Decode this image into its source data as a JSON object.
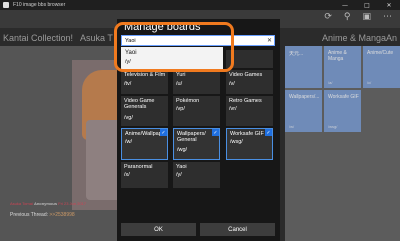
{
  "window": {
    "title": "F10 image bbs browser",
    "minimize_icon": "minimize-icon",
    "maximize_icon": "maximize-icon",
    "close_icon": "close-icon"
  },
  "appbar": {
    "icons": [
      "refresh-icon",
      "search-icon",
      "tabs-icon",
      "more-icon"
    ]
  },
  "boards": {
    "items": [
      "Kantai Collection!",
      "Asuka T",
      "Anime & Manga",
      "An"
    ]
  },
  "left_post": {
    "post_number": "1497247793",
    "meta_name": "Asuka Tomai",
    "meta_user": "Anonymous",
    "meta_date": "Fri 23 Jun 2017",
    "prev_label": "Previous Thread:",
    "prev_link": ">>2538998"
  },
  "right_tiles": [
    {
      "title": "天元...",
      "sub": ""
    },
    {
      "title": "Anime & Manga",
      "sub": "/a/"
    },
    {
      "title": "Anime/Cute",
      "sub": "/c/"
    },
    {
      "title": "Wallpapers/...",
      "sub": "/w/"
    },
    {
      "title": "Worksafe GIF",
      "sub": "/wsg/"
    }
  ],
  "dialog": {
    "title": "Manage boards",
    "search_value": "Yaoi",
    "clear_icon": "clear-icon",
    "suggestion": {
      "name": "Yaoi",
      "code": "/y/"
    },
    "rows": [
      [
        {
          "name": "",
          "code": ""
        },
        {
          "name": "",
          "code": ""
        },
        {
          "name": "",
          "code": ""
        }
      ],
      [
        {
          "name": "Television & Film",
          "code": "/tv/"
        },
        {
          "name": "Yuri",
          "code": "/u/"
        },
        {
          "name": "Video Games",
          "code": "/v/"
        }
      ],
      [
        {
          "name": "Video Game Generals",
          "code": "/vg/"
        },
        {
          "name": "Pokémon",
          "code": "/vp/"
        },
        {
          "name": "Retro Games",
          "code": "/vr/"
        }
      ],
      [
        {
          "name": "Anime/Wallpapers",
          "code": "/w/",
          "selected": true
        },
        {
          "name": "Wallpapers/ General",
          "code": "/wg/",
          "selected": true
        },
        {
          "name": "Worksafe GIF",
          "code": "/wsg/",
          "selected": true
        }
      ],
      [
        {
          "name": "Paranormal",
          "code": "/x/"
        },
        {
          "name": "Yaoi",
          "code": "/y/"
        },
        {
          "name": "",
          "code": ""
        }
      ]
    ],
    "ok_label": "OK",
    "cancel_label": "Cancel"
  },
  "colors": {
    "accent": "#1f6fe0",
    "highlight": "#f07a1f",
    "dialog_bg": "#171717"
  }
}
